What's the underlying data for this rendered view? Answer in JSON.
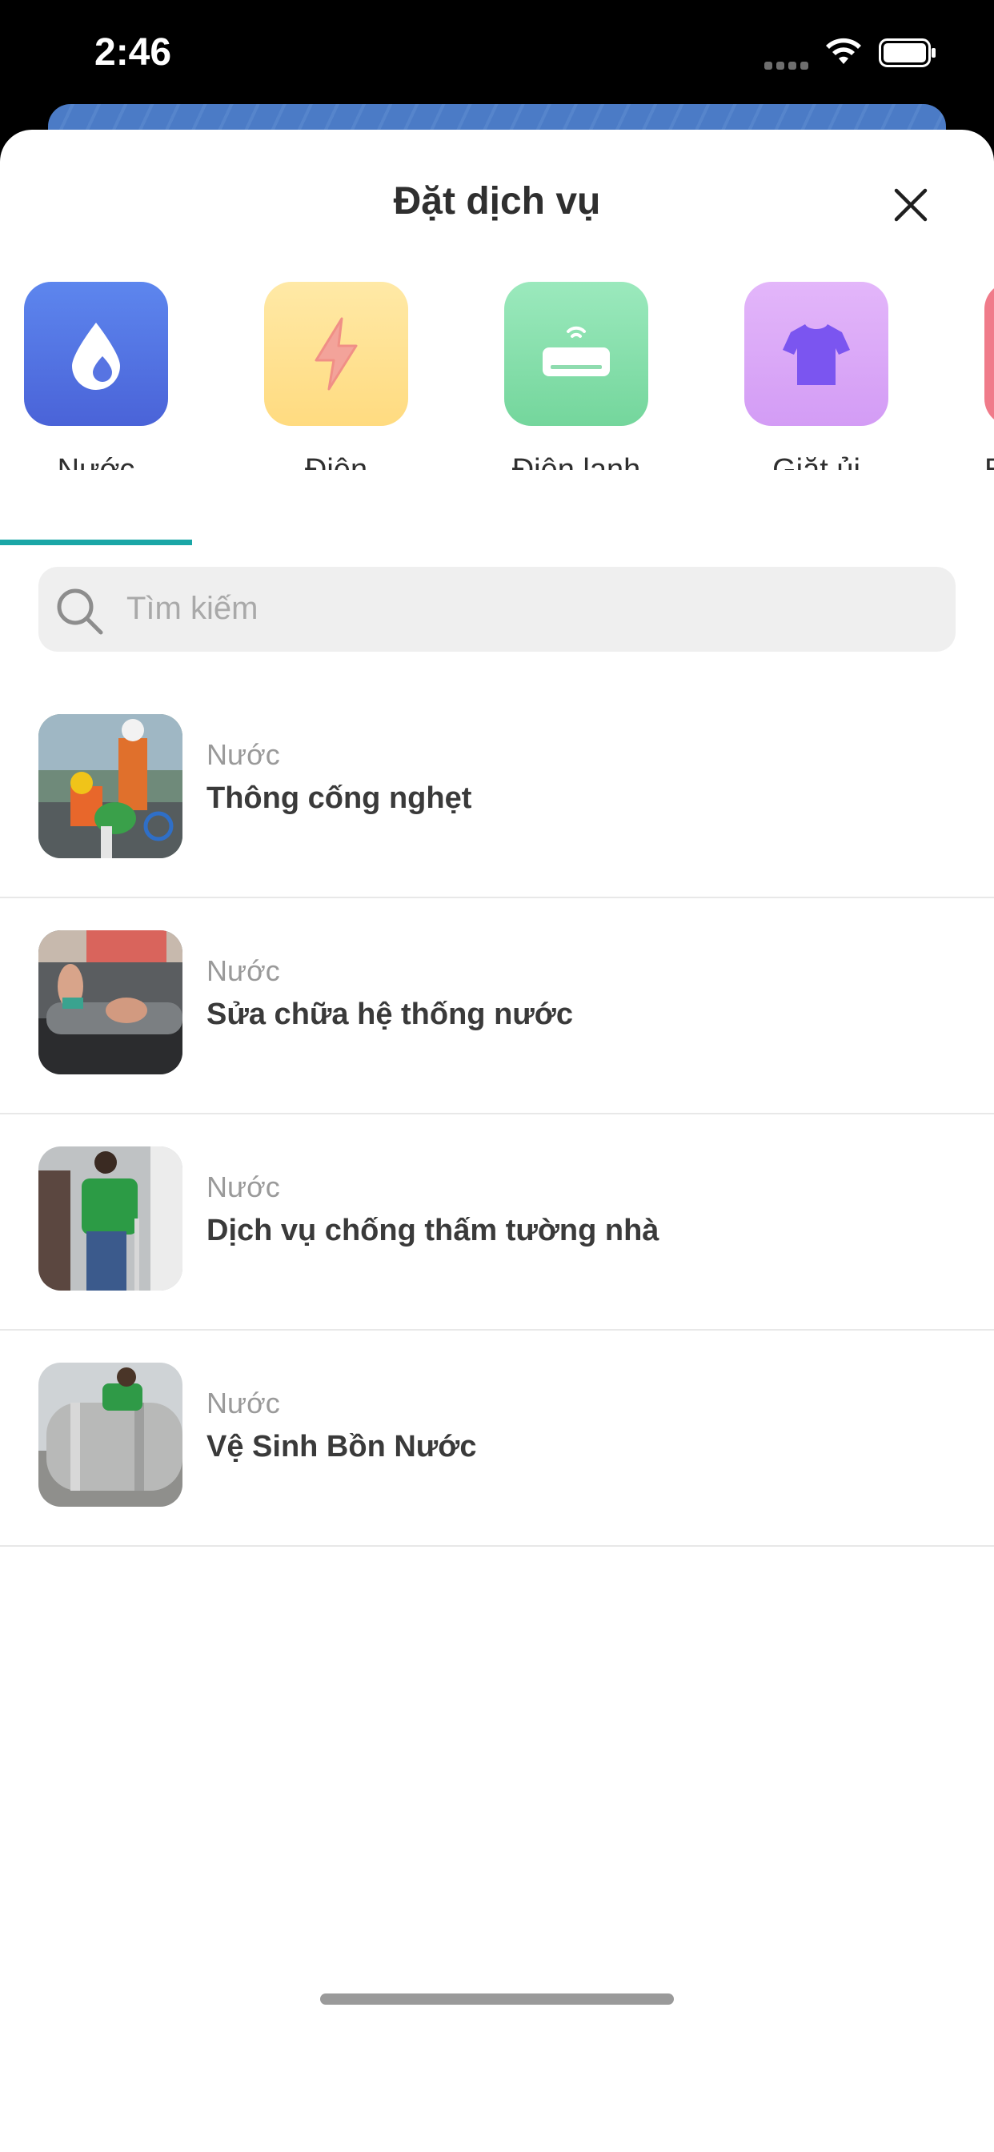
{
  "status": {
    "time": "2:46"
  },
  "sheet": {
    "title": "Đặt dịch vụ"
  },
  "categories": [
    {
      "label": "Nước",
      "icon": "water-drop-icon",
      "color": "#5577e4"
    },
    {
      "label": "Điện",
      "icon": "lightning-icon",
      "color": "#ffe08a"
    },
    {
      "label": "Điện lạnh",
      "icon": "air-conditioner-icon",
      "color": "#86e0ac"
    },
    {
      "label": "Giặt ủi",
      "icon": "t-shirt-icon",
      "color": "#d9a6f7"
    },
    {
      "label": "E",
      "icon": "partial-category-icon",
      "color": "#f07b8a"
    }
  ],
  "search": {
    "placeholder": "Tìm kiếm"
  },
  "services": [
    {
      "category": "Nước",
      "name": "Thông cống nghẹt"
    },
    {
      "category": "Nước",
      "name": "Sửa chữa hệ thống nước"
    },
    {
      "category": "Nước",
      "name": "Dịch vụ chống thấm tường nhà"
    },
    {
      "category": "Nước",
      "name": "Vệ Sinh Bồn Nước"
    }
  ],
  "colors": {
    "accent": "#1aa6a6"
  }
}
